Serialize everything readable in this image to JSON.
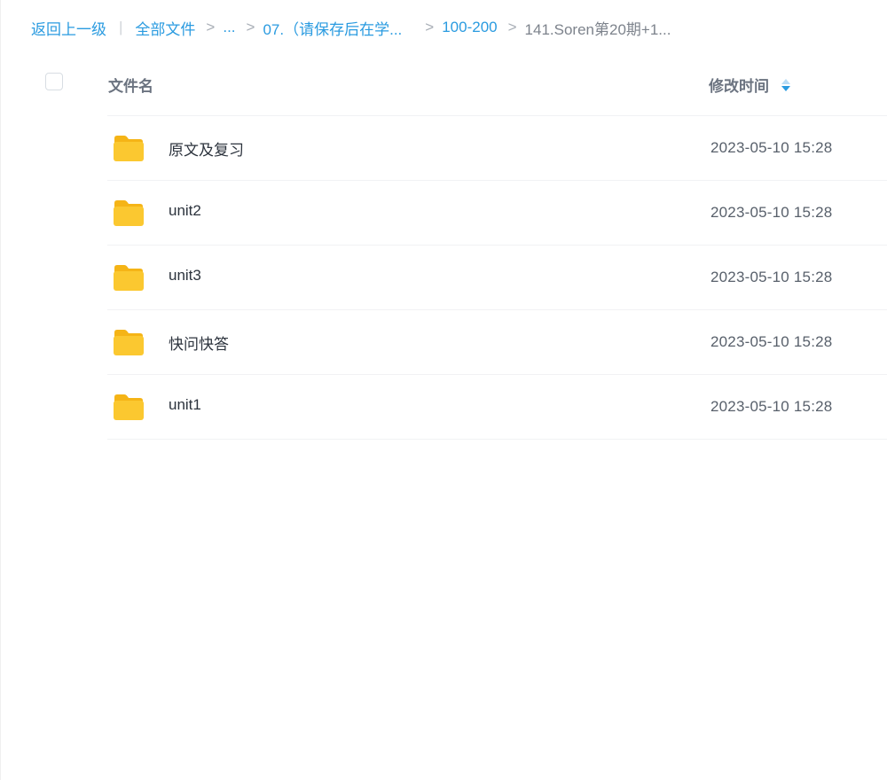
{
  "breadcrumb": {
    "back_label": "返回上一级",
    "divider": "|",
    "items": [
      {
        "label": "全部文件"
      },
      {
        "label": "..."
      },
      {
        "label": "07.（请保存后在学..."
      },
      {
        "label": "100-200"
      }
    ],
    "current": "141.Soren第20期+1...",
    "separator": ">"
  },
  "table": {
    "columns": {
      "name": "文件名",
      "modified": "修改时间"
    },
    "sort": "modified-descending",
    "rows": [
      {
        "name": "原文及复习",
        "modified": "2023-05-10 15:28",
        "icon": "folder-icon"
      },
      {
        "name": "unit2",
        "modified": "2023-05-10 15:28",
        "icon": "folder-icon"
      },
      {
        "name": "unit3",
        "modified": "2023-05-10 15:28",
        "icon": "folder-icon"
      },
      {
        "name": "快问快答",
        "modified": "2023-05-10 15:28",
        "icon": "folder-icon"
      },
      {
        "name": "unit1",
        "modified": "2023-05-10 15:28",
        "icon": "folder-icon"
      }
    ]
  },
  "colors": {
    "link": "#2a9be0",
    "folder": "#fbc830",
    "folder_back": "#f5b416"
  }
}
